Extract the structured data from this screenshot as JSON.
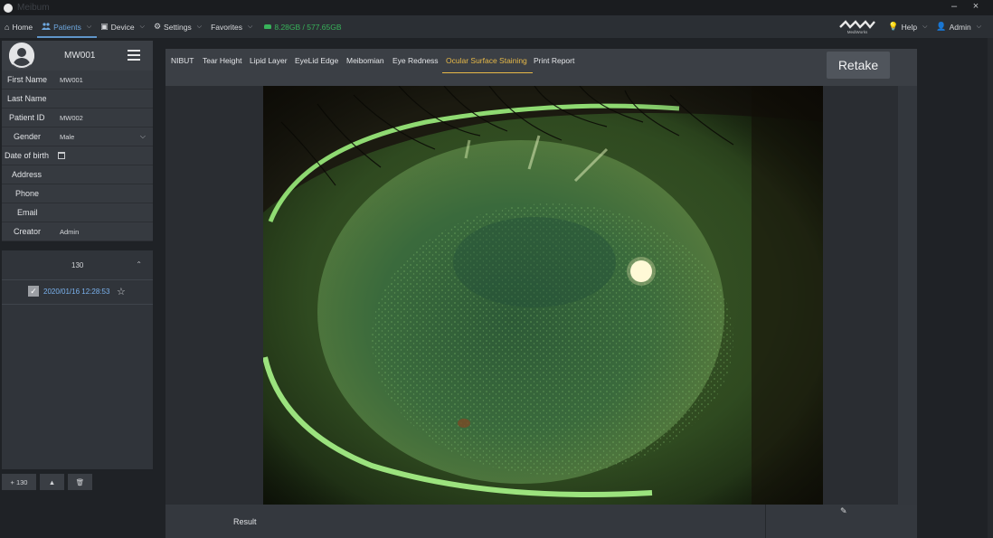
{
  "window": {
    "title": "Meibum",
    "minimize_label": "–",
    "close_label": "×"
  },
  "nav": {
    "items": [
      {
        "icon": "home-icon",
        "glyph": "⌂",
        "label": "Home",
        "dropdown": false
      },
      {
        "icon": "users-icon",
        "glyph": "👥",
        "label": "Patients",
        "dropdown": true,
        "active": true
      },
      {
        "icon": "device-icon",
        "glyph": "▣",
        "label": "Device",
        "dropdown": true
      },
      {
        "icon": "gear-icon",
        "glyph": "⚙",
        "label": "Settings",
        "dropdown": true
      },
      {
        "icon": "",
        "glyph": "",
        "label": "Favorites",
        "dropdown": true
      }
    ],
    "storage": "8.28GB / 577.65GB",
    "storage_color": "#38b25a",
    "brand": "MediWorks",
    "help": "Help",
    "user": "Admin"
  },
  "patient": {
    "header_id": "MW001",
    "fields": [
      {
        "label": "First Name",
        "value": "MW001"
      },
      {
        "label": "Last Name",
        "value": ""
      },
      {
        "label": "Patient ID",
        "value": "MW002"
      },
      {
        "label": "Gender",
        "value": "Male"
      },
      {
        "label": "Date of birth",
        "value": ""
      },
      {
        "label": "Address",
        "value": ""
      },
      {
        "label": "Phone",
        "value": ""
      },
      {
        "label": "Email",
        "value": ""
      },
      {
        "label": "Creator",
        "value": "Admin"
      }
    ]
  },
  "history": {
    "count": "130",
    "records": [
      {
        "datetime": "2020/01/16 12:28:53",
        "checked": true
      }
    ]
  },
  "footer_buttons": {
    "add": "+ 130",
    "up": "▲",
    "delete": "🗑"
  },
  "tabs": [
    {
      "label": "NIBUT"
    },
    {
      "label": "Tear Height"
    },
    {
      "label": "Lipid Layer"
    },
    {
      "label": "EyeLid Edge"
    },
    {
      "label": "Meibomian"
    },
    {
      "label": "Eye Redness"
    },
    {
      "label": "Ocular Surface Staining",
      "active": true
    },
    {
      "label": "Print Report"
    }
  ],
  "retake_label": "Retake",
  "result_label": "Result",
  "accent_color": "#e7b948",
  "link_color": "#7ab2ee"
}
